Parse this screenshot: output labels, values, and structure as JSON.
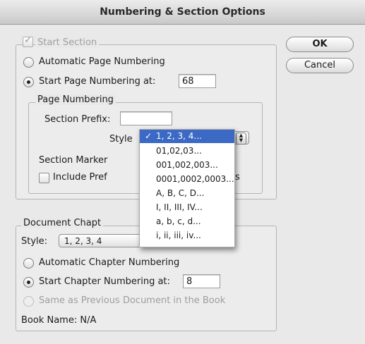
{
  "window": {
    "title": "Numbering & Section Options"
  },
  "buttons": {
    "ok": "OK",
    "cancel": "Cancel"
  },
  "section": {
    "start_section_label": "Start Section",
    "auto_page_numbering": "Automatic Page Numbering",
    "start_page_numbering_at": "Start Page Numbering at:",
    "start_page_value": "68",
    "page_numbering_group": "Page Numbering",
    "section_prefix_label": "Section Prefix:",
    "section_prefix_value": "",
    "style_label": "Style",
    "section_marker_label": "Section Marker",
    "include_prefix_label": "Include Pref",
    "include_prefix_tail": "s"
  },
  "style_menu": {
    "check_glyph": "✓",
    "items": [
      "1, 2, 3, 4...",
      "01,02,03...",
      "001,002,003...",
      "0001,0002,0003...",
      "A, B, C, D...",
      "I, II, III, IV...",
      "a, b, c, d...",
      "i, ii, iii, iv..."
    ]
  },
  "chapter": {
    "group_label": "Document Chapt",
    "style_label": "Style:",
    "style_value": "1, 2, 3, 4",
    "auto_chapter_numbering": "Automatic Chapter Numbering",
    "start_chapter_numbering_at": "Start Chapter Numbering at:",
    "start_chapter_value": "8",
    "same_as_previous": "Same as Previous Document in the Book",
    "book_name": "Book Name: N/A"
  },
  "colors": {
    "menu_highlight": "#3c69c4",
    "window_bg": "#e9e9e9"
  }
}
